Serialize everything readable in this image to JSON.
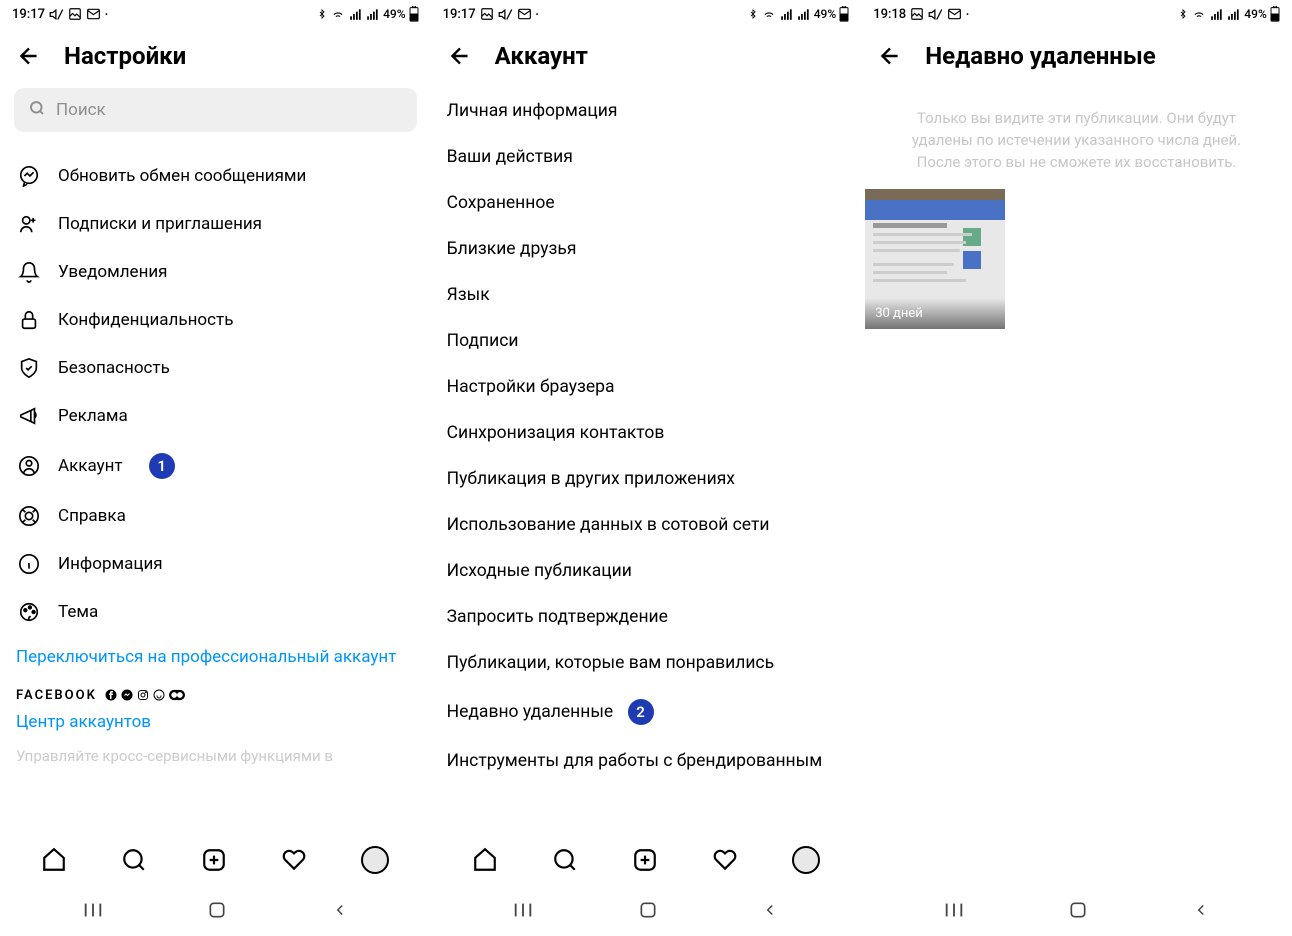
{
  "screens": [
    {
      "status": {
        "time": "19:17",
        "battery": "49%"
      },
      "header": {
        "title": "Настройки"
      },
      "search": {
        "placeholder": "Поиск"
      },
      "items": [
        {
          "label": "Обновить обмен сообщениями",
          "icon": "messenger"
        },
        {
          "label": "Подписки и приглашения",
          "icon": "follow"
        },
        {
          "label": "Уведомления",
          "icon": "bell"
        },
        {
          "label": "Конфиденциальность",
          "icon": "lock"
        },
        {
          "label": "Безопасность",
          "icon": "shield"
        },
        {
          "label": "Реклама",
          "icon": "megaphone"
        },
        {
          "label": "Аккаунт",
          "icon": "account",
          "badge": "1"
        },
        {
          "label": "Справка",
          "icon": "help"
        },
        {
          "label": "Информация",
          "icon": "info"
        },
        {
          "label": "Тема",
          "icon": "theme"
        }
      ],
      "link": "Переключиться на профессиональный аккаунт",
      "facebook_label": "FACEBOOK",
      "accounts_center": "Центр аккаунтов",
      "faded": "Управляйте кросс-сервисными функциями в"
    },
    {
      "status": {
        "time": "19:17",
        "battery": "49%"
      },
      "header": {
        "title": "Аккаунт"
      },
      "items": [
        {
          "label": "Личная информация"
        },
        {
          "label": "Ваши действия"
        },
        {
          "label": "Сохраненное"
        },
        {
          "label": "Близкие друзья"
        },
        {
          "label": "Язык"
        },
        {
          "label": "Подписи"
        },
        {
          "label": "Настройки браузера"
        },
        {
          "label": "Синхронизация контактов"
        },
        {
          "label": "Публикация в других приложениях"
        },
        {
          "label": "Использование данных в сотовой сети"
        },
        {
          "label": "Исходные публикации"
        },
        {
          "label": "Запросить подтверждение"
        },
        {
          "label": "Публикации, которые вам понравились"
        },
        {
          "label": "Недавно удаленные",
          "badge": "2"
        },
        {
          "label": "Инструменты для работы с брендированным"
        }
      ]
    },
    {
      "status": {
        "time": "19:18",
        "battery": "49%"
      },
      "header": {
        "title": "Недавно удаленные"
      },
      "info": "Только вы видите эти публикации. Они будут удалены по истечении указанного числа дней. После этого вы не сможете их восстановить.",
      "thumb": {
        "label": "30 дней"
      }
    }
  ]
}
